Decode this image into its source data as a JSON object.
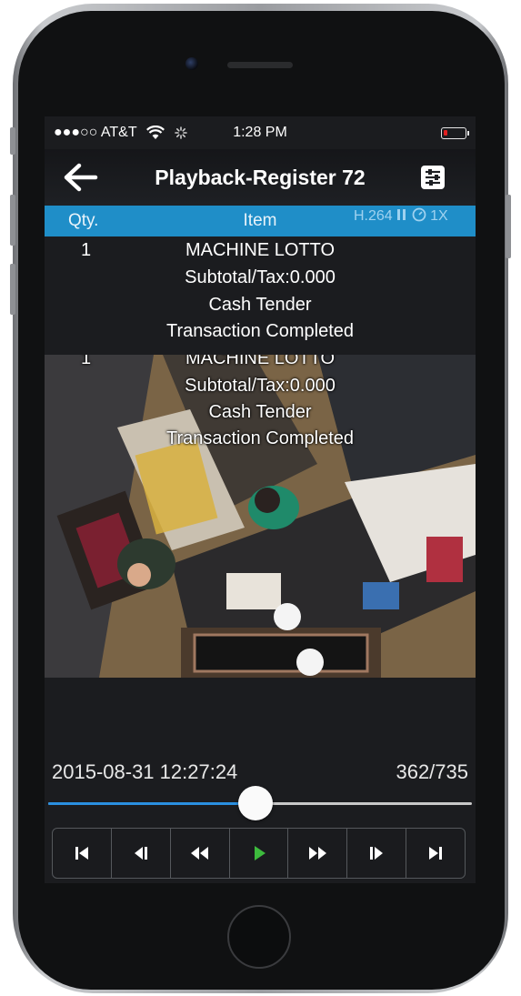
{
  "status_bar": {
    "carrier": "●●●○○ AT&T",
    "time": "1:28 PM",
    "icons": [
      "signal-dots-icon",
      "wifi-icon",
      "activity-spinner-icon",
      "battery-low-icon"
    ]
  },
  "nav": {
    "title": "Playback-Register 72",
    "back_icon": "back-arrow-icon",
    "settings_icon": "sliders-icon"
  },
  "table_header": {
    "qty": "Qty.",
    "item": "Item",
    "codec": "H.264",
    "speed": "1X"
  },
  "transactions": [
    {
      "qty": "1",
      "text": "MACHINE LOTTO"
    },
    {
      "qty": "",
      "text": "Subtotal/Tax:0.000"
    },
    {
      "qty": "",
      "text": "Cash Tender"
    },
    {
      "qty": "",
      "text": "Transaction Completed"
    }
  ],
  "video_overlay": [
    {
      "qty": "1",
      "text": "MACHINE LOTTO"
    },
    {
      "qty": "",
      "text": "Subtotal/Tax:0.000"
    },
    {
      "qty": "",
      "text": "Cash Tender"
    },
    {
      "qty": "",
      "text": "Transaction Completed"
    }
  ],
  "playback": {
    "timestamp": "2015-08-31 12:27:24",
    "frame_counter": "362/735",
    "progress_fraction": 0.49
  },
  "controls": [
    {
      "icon": "skip-to-start-icon"
    },
    {
      "icon": "step-back-icon"
    },
    {
      "icon": "rewind-icon"
    },
    {
      "icon": "play-icon"
    },
    {
      "icon": "fast-forward-icon"
    },
    {
      "icon": "step-forward-icon"
    },
    {
      "icon": "skip-to-end-icon"
    }
  ],
  "colors": {
    "header_blue": "#1f8ec8",
    "timeline_blue": "#2a8fe0",
    "play_green": "#3dbb3d",
    "battery_red": "#e02020"
  }
}
